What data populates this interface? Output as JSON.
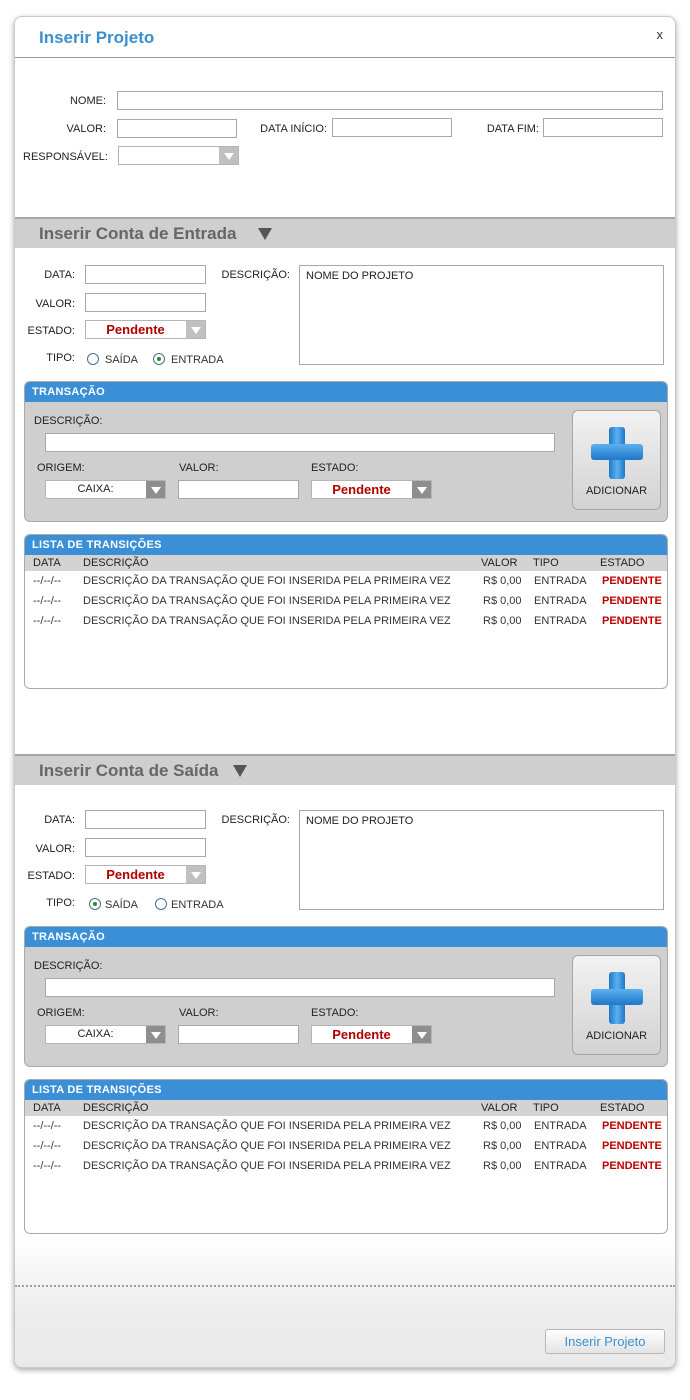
{
  "dialog": {
    "title": "Inserir Projeto",
    "close_label": "x"
  },
  "project": {
    "nome_label": "NOME:",
    "valor_label": "VALOR:",
    "data_inicio_label": "DATA INÍCIO:",
    "data_fim_label": "DATA FIM:",
    "responsavel_label": "RESPONSÁVEL:",
    "nome_value": "",
    "valor_value": "",
    "data_inicio_value": "",
    "data_fim_value": "",
    "responsavel_value": ""
  },
  "entrada": {
    "title": "Inserir Conta de Entrada",
    "data_label": "DATA:",
    "valor_label": "VALOR:",
    "estado_label": "ESTADO:",
    "tipo_label": "TIPO:",
    "descricao_label": "DESCRIÇÃO:",
    "descricao_value": "NOME DO PROJETO",
    "estado_value": "Pendente",
    "tipo_options": [
      "SAÍDA",
      "ENTRADA"
    ],
    "tipo_selected": "ENTRADA",
    "transacao": {
      "header": "TRANSAÇÃO",
      "descricao_label": "DESCRIÇÃO:",
      "origem_label": "ORIGEM:",
      "valor_label": "VALOR:",
      "estado_label": "ESTADO:",
      "origem_value": "CAIXA:",
      "estado_value": "Pendente",
      "add_label": "ADICIONAR"
    },
    "lista": {
      "header": "LISTA DE TRANSIÇÕES",
      "columns": [
        "DATA",
        "DESCRIÇÃO",
        "VALOR",
        "TIPO",
        "ESTADO"
      ],
      "rows": [
        [
          "--/--/--",
          "DESCRIÇÃO DA TRANSAÇÃO QUE FOI INSERIDA PELA PRIMEIRA VEZ",
          "R$ 0,00",
          "ENTRADA",
          "PENDENTE"
        ],
        [
          "--/--/--",
          "DESCRIÇÃO DA TRANSAÇÃO QUE FOI INSERIDA PELA PRIMEIRA VEZ",
          "R$ 0,00",
          "ENTRADA",
          "PENDENTE"
        ],
        [
          "--/--/--",
          "DESCRIÇÃO DA TRANSAÇÃO QUE FOI INSERIDA PELA PRIMEIRA VEZ",
          "R$ 0,00",
          "ENTRADA",
          "PENDENTE"
        ]
      ]
    }
  },
  "saida": {
    "title": "Inserir Conta de Saída",
    "data_label": "DATA:",
    "valor_label": "VALOR:",
    "estado_label": "ESTADO:",
    "tipo_label": "TIPO:",
    "descricao_label": "DESCRIÇÃO:",
    "descricao_value": "NOME DO PROJETO",
    "estado_value": "Pendente",
    "tipo_options": [
      "SAÍDA",
      "ENTRADA"
    ],
    "tipo_selected": "SAÍDA",
    "transacao": {
      "header": "TRANSAÇÃO",
      "descricao_label": "DESCRIÇÃO:",
      "origem_label": "ORIGEM:",
      "valor_label": "VALOR:",
      "estado_label": "ESTADO:",
      "origem_value": "CAIXA:",
      "estado_value": "Pendente",
      "add_label": "ADICIONAR"
    },
    "lista": {
      "header": "LISTA DE TRANSIÇÕES",
      "columns": [
        "DATA",
        "DESCRIÇÃO",
        "VALOR",
        "TIPO",
        "ESTADO"
      ],
      "rows": [
        [
          "--/--/--",
          "DESCRIÇÃO DA TRANSAÇÃO QUE FOI INSERIDA PELA PRIMEIRA VEZ",
          "R$ 0,00",
          "ENTRADA",
          "PENDENTE"
        ],
        [
          "--/--/--",
          "DESCRIÇÃO DA TRANSAÇÃO QUE FOI INSERIDA PELA PRIMEIRA VEZ",
          "R$ 0,00",
          "ENTRADA",
          "PENDENTE"
        ],
        [
          "--/--/--",
          "DESCRIÇÃO DA TRANSAÇÃO QUE FOI INSERIDA PELA PRIMEIRA VEZ",
          "R$ 0,00",
          "ENTRADA",
          "PENDENTE"
        ]
      ]
    }
  },
  "footer": {
    "submit_label": "Inserir Projeto"
  },
  "icons": {
    "dropdown": "chevron-down-icon",
    "add": "plus-icon",
    "collapse": "triangle-down-icon"
  },
  "colors": {
    "accent": "#3b8fd6",
    "status_red": "#c00000",
    "title_blue": "#3a8fd0"
  }
}
